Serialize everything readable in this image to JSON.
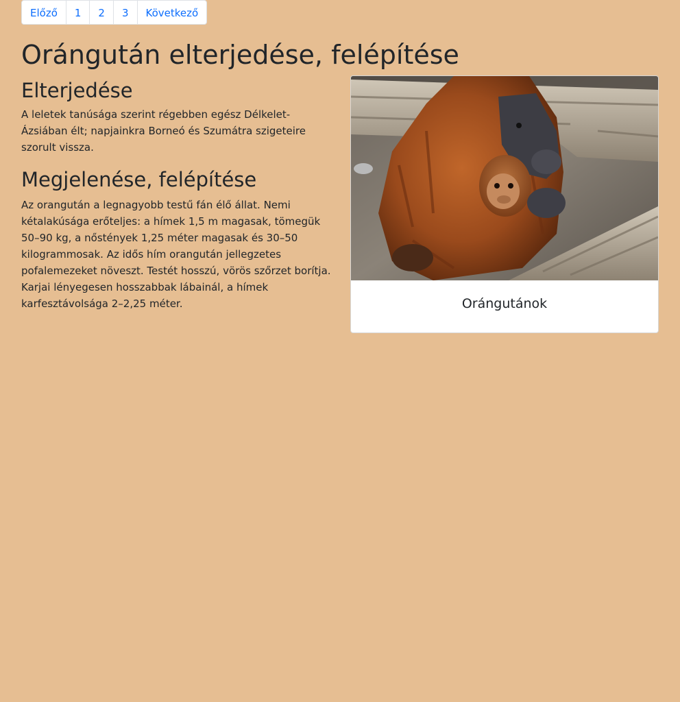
{
  "pagination": {
    "prev_label": "Előző",
    "pages": [
      "1",
      "2",
      "3"
    ],
    "next_label": "Következő"
  },
  "page": {
    "title": "Orángután elterjedése, felépítése"
  },
  "sections": [
    {
      "heading": "Elterjedése",
      "text": "A leletek tanúsága szerint régebben egész Délkelet-Ázsiában élt; napjainkra Borneó és Szumátra szigeteire szorult vissza."
    },
    {
      "heading": "Megjelenése, felépítése",
      "text": "Az orangután a legnagyobb testű fán élő állat. Nemi kétalakúsága erőteljes: a hímek 1,5 m magasak, tömegük 50–90 kg, a nőstények 1,25 méter magasak és 30–50 kilogrammosak. Az idős hím orangután jellegzetes pofalemezeket növeszt. Testét hosszú, vörös szőrzet borítja. Karjai lényegesen hosszabbak lábainál, a hímek karfesztávolsága 2–2,25 méter."
    }
  ],
  "card": {
    "caption": "Orángutánok",
    "image_subject": "orangutan mother holding baby on wooden logs"
  },
  "colors": {
    "background": "#e6be92",
    "link": "#0d6efd",
    "text": "#212529"
  }
}
